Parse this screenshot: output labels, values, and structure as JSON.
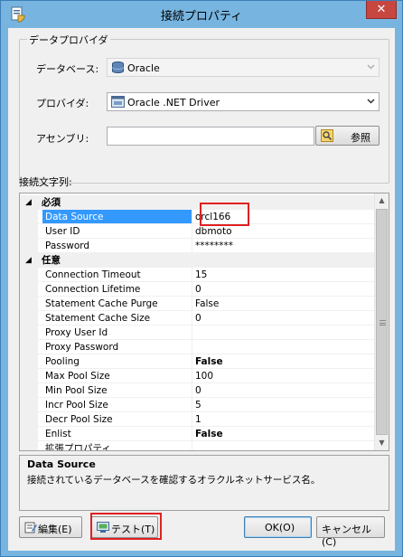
{
  "window": {
    "title": "接続プロパティ",
    "close_glyph": "✕"
  },
  "provider_group": {
    "title": "データプロバイダ",
    "database_label": "データベース:",
    "database_value": "Oracle",
    "provider_label": "プロバイダ:",
    "provider_value": "Oracle .NET Driver",
    "assembly_label": "アセンブリ:",
    "assembly_value": "",
    "browse_label": "参照"
  },
  "connection_string_label": "接続文字列:",
  "property_grid": {
    "categories": [
      {
        "name": "必須",
        "expander": "◢",
        "rows": [
          {
            "name": "Data Source",
            "value": "orcl166",
            "selected": true
          },
          {
            "name": "User ID",
            "value": "dbmoto"
          },
          {
            "name": "Password",
            "value": "********"
          }
        ]
      },
      {
        "name": "任意",
        "expander": "◢",
        "rows": [
          {
            "name": "Connection Timeout",
            "value": "15"
          },
          {
            "name": "Connection Lifetime",
            "value": "0"
          },
          {
            "name": "Statement Cache Purge",
            "value": "False"
          },
          {
            "name": "Statement Cache Size",
            "value": "0"
          },
          {
            "name": "Proxy User Id",
            "value": ""
          },
          {
            "name": "Proxy Password",
            "value": ""
          },
          {
            "name": "Pooling",
            "value": "False",
            "bold": true
          },
          {
            "name": "Max Pool Size",
            "value": "100"
          },
          {
            "name": "Min Pool Size",
            "value": "0"
          },
          {
            "name": "Incr Pool Size",
            "value": "5"
          },
          {
            "name": "Decr Pool Size",
            "value": "1"
          },
          {
            "name": "Enlist",
            "value": "False",
            "bold": true
          },
          {
            "name": "拡張プロパティ",
            "value": ""
          }
        ]
      }
    ],
    "scroll_up": "▲",
    "scroll_down": "▼"
  },
  "description": {
    "title": "Data Source",
    "text": "接続されているデータベースを確認するオラクルネットサービス名。"
  },
  "buttons": {
    "edit": "編集(E)",
    "test": "テスト(T)",
    "ok": "OK(O)",
    "cancel": "キャンセル(C)"
  },
  "colors": {
    "selection": "#3399ff",
    "highlight_box": "#e02020",
    "title_bar": "#77b5e0"
  }
}
